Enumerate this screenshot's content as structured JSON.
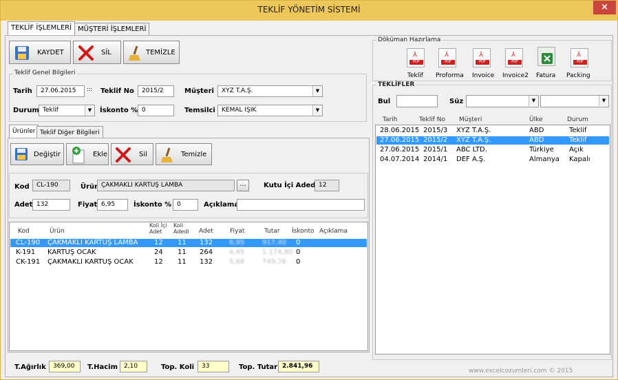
{
  "window": {
    "title": "TEKLİF YÖNETİM SİSTEMİ",
    "close": "×"
  },
  "main_tabs": [
    "TEKLİF İŞLEMLERİ",
    "MÜŞTERİ İŞLEMLERİ"
  ],
  "toolbar": {
    "save": "KAYDET",
    "delete": "SİL",
    "clear": "TEMİZLE"
  },
  "general": {
    "title": "Teklif Genel Bilgileri",
    "date_label": "Tarih",
    "date_value": "27.06.2015",
    "date_picker": ":::",
    "no_label": "Teklif No",
    "no_value": "2015/2",
    "customer_label": "Müşteri",
    "customer_value": "XYZ T.A.Ş.",
    "status_label": "Durum",
    "status_value": "Teklif",
    "discount_label": "İskonto %",
    "discount_value": "0",
    "rep_label": "Temsilci",
    "rep_value": "KEMAL IŞIK"
  },
  "sub_tabs": [
    "Ürünler",
    "Teklif Diğer Bilgileri"
  ],
  "item_toolbar": {
    "change": "Değiştir",
    "add": "Ekle",
    "delete": "Sil",
    "clear": "Temizle"
  },
  "item_form": {
    "code_label": "Kod",
    "code_value": "CL-190",
    "product_label": "Ürün",
    "product_value": "ÇAKMAKLI KARTUŞ LAMBA",
    "browse": "...",
    "box_label": "Kutu İçi Adedi",
    "box_value": "12",
    "qty_label": "Adet",
    "qty_value": "132",
    "price_label": "Fiyat",
    "price_value": "6,95",
    "disc_label": "İskonto %",
    "disc_value": "0",
    "note_label": "Açıklama",
    "note_value": ""
  },
  "items_table": {
    "headers": [
      "Kod",
      "Ürün",
      "Koli İçi Adet",
      "Koli Adedi",
      "Adet",
      "Fiyat",
      "Tutar",
      "İskonto",
      "Açıklama"
    ],
    "rows": [
      [
        "CL-190",
        "ÇAKMAKLI KARTUŞ LAMBA",
        "12",
        "11",
        "132",
        "6,95",
        "917,40",
        "0",
        ""
      ],
      [
        "K-191",
        "KARTUŞ OCAK",
        "24",
        "11",
        "264",
        "4,45",
        "1.174,80",
        "0",
        ""
      ],
      [
        "CK-191",
        "ÇAKMAKLI KARTUŞ OCAK",
        "12",
        "11",
        "132",
        "5,68",
        "749,76",
        "0",
        ""
      ]
    ],
    "selected": 0
  },
  "totals": {
    "weight_label": "T.Ağırlık",
    "weight_value": "369,00",
    "volume_label": "T.Hacim",
    "volume_value": "2,10",
    "boxes_label": "Top. Koli",
    "boxes_value": "33",
    "amount_label": "Top. Tutar",
    "amount_value": "2.841,96"
  },
  "documents": {
    "title": "Döküman Hazırlama",
    "items": [
      "Teklif",
      "Proforma",
      "Invoice",
      "Invoice2",
      "Fatura",
      "Packing"
    ],
    "pdf_tag": "PDF"
  },
  "offers": {
    "title": "TEKLİFLER",
    "find_label": "Bul",
    "filter_label": "Süz",
    "headers": [
      "Tarih",
      "Teklif No",
      "Müşteri",
      "Ülke",
      "Durum"
    ],
    "rows": [
      [
        "28.06.2015",
        "2015/3",
        "XYZ T.A.Ş.",
        "ABD",
        "Teklif"
      ],
      [
        "27.06.2015",
        "2015/2",
        "XYZ T.A.Ş.",
        "ABD",
        "Teklif"
      ],
      [
        "27.06.2015",
        "2015/1",
        "ABC LTD.",
        "Türkiye",
        "Açık"
      ],
      [
        "04.07.2014",
        "2014/1",
        "DEF A.Ş.",
        "Almanya",
        "Kapalı"
      ]
    ],
    "selected": 1
  },
  "footer": "www.excelcozumleri.com © 2015",
  "colors": {
    "titlebar": "#eec75a",
    "close": "#c9463d",
    "selection": "#3399ff",
    "total_bg": "#ffffcc"
  }
}
